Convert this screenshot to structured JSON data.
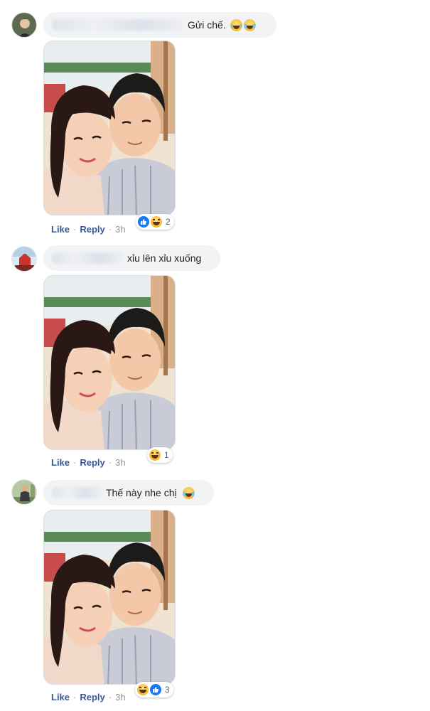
{
  "comments": [
    {
      "text": "Gửi chế.",
      "emoji": [
        "tears-of-joy",
        "tears-of-joy"
      ],
      "actions": {
        "like": "Like",
        "reply": "Reply",
        "time": "3h"
      },
      "reactions": {
        "icons": [
          "like",
          "haha"
        ],
        "count": "2"
      }
    },
    {
      "text": "xỉu lên xỉu xuống",
      "emoji": [],
      "actions": {
        "like": "Like",
        "reply": "Reply",
        "time": "3h"
      },
      "reactions": {
        "icons": [
          "haha"
        ],
        "count": "1"
      }
    },
    {
      "text": "Thế này nhe chị",
      "emoji": [
        "tears-of-joy"
      ],
      "actions": {
        "like": "Like",
        "reply": "Reply",
        "time": "3h"
      },
      "reactions": {
        "icons": [
          "haha",
          "like"
        ],
        "count": "3"
      }
    }
  ],
  "separator": "·",
  "colors": {
    "link": "#385898",
    "bubble": "#f2f3f5",
    "meta": "#90949c",
    "like_blue": "#1877f2"
  }
}
